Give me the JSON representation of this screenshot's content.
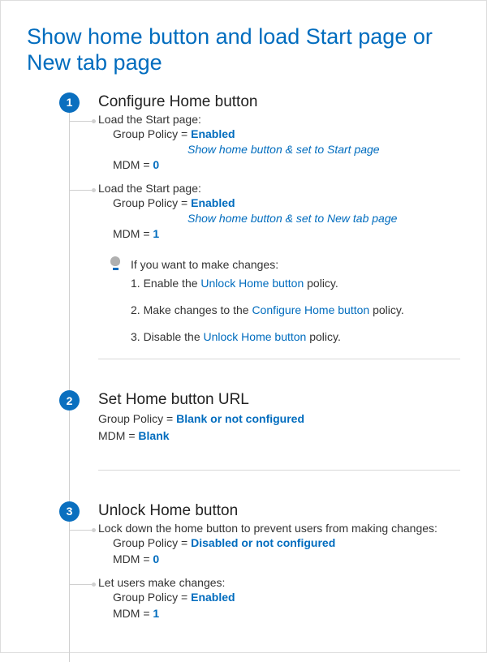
{
  "title": "Show home button and load Start page or New tab page",
  "steps": [
    {
      "num": "1",
      "title": "Configure Home button",
      "options": [
        {
          "label": "Load the Start page:",
          "gp_key": "Group Policy",
          "gp_val": "Enabled",
          "sub": "Show home button & set to Start page",
          "mdm_key": "MDM",
          "mdm_val": "0"
        },
        {
          "label": "Load the Start page:",
          "gp_key": "Group Policy",
          "gp_val": "Enabled",
          "sub": "Show home button & set to New tab page",
          "mdm_key": "MDM",
          "mdm_val": "1"
        }
      ],
      "tip": {
        "intro": "If you want to make changes:",
        "items": [
          {
            "pre": "1. Enable the ",
            "link": "Unlock Home button",
            "post": " policy."
          },
          {
            "pre": "2. Make changes to the ",
            "link": "Configure Home button",
            "post": " policy."
          },
          {
            "pre": "3. Disable the ",
            "link": "Unlock Home button",
            "post": " policy."
          }
        ]
      }
    },
    {
      "num": "2",
      "title": "Set Home button URL",
      "flat": [
        {
          "k": "Group Policy",
          "v": "Blank or not configured"
        },
        {
          "k": "MDM",
          "v": "Blank"
        }
      ]
    },
    {
      "num": "3",
      "title": "Unlock Home button",
      "options": [
        {
          "label": "Lock down the home button to prevent users from making changes:",
          "gp_key": "Group Policy",
          "gp_val": "Disabled or not configured",
          "mdm_key": "MDM",
          "mdm_val": "0"
        },
        {
          "label": "Let users make changes:",
          "gp_key": "Group Policy",
          "gp_val": "Enabled",
          "mdm_key": "MDM",
          "mdm_val": "1"
        }
      ]
    }
  ]
}
